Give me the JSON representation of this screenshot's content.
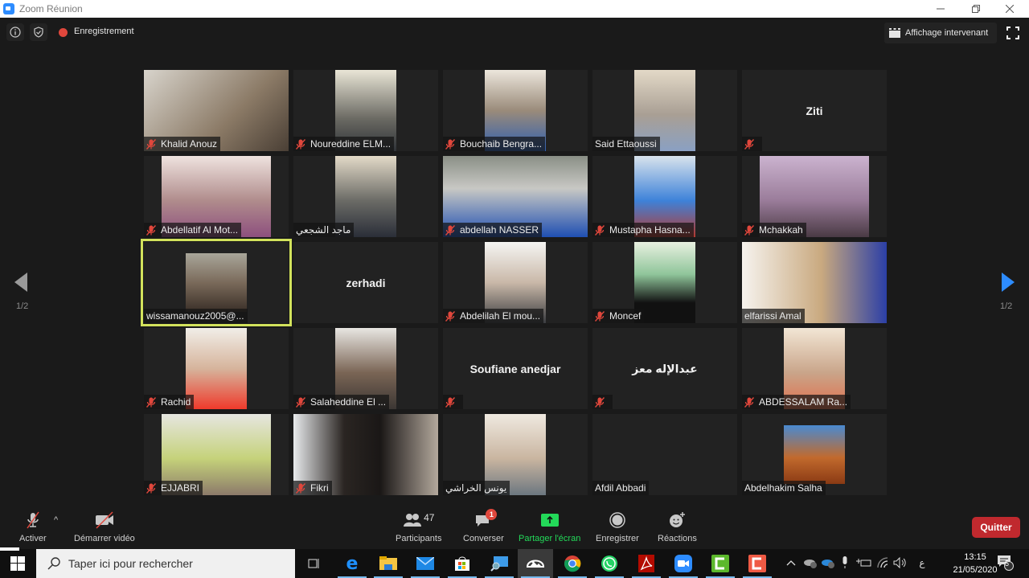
{
  "window": {
    "title": "Zoom Réunion",
    "controls": [
      "minimize",
      "restore",
      "close"
    ]
  },
  "topbar": {
    "recording_label": "Enregistrement",
    "speaker_view_label": "Affichage intervenant"
  },
  "pagination": {
    "left": "1/2",
    "right": "1/2"
  },
  "participants": [
    {
      "name": "Khalid Anouz",
      "muted": true,
      "video": "wide"
    },
    {
      "name": "Noureddine ELM...",
      "muted": true,
      "video": "narrow"
    },
    {
      "name": "Bouchaib Bengra...",
      "muted": true,
      "video": "narrow"
    },
    {
      "name": "Said Ettaoussi",
      "muted": false,
      "video": "narrow"
    },
    {
      "name": "",
      "display_name": "Ziti",
      "muted": true,
      "video": "none"
    },
    {
      "name": "Abdellatif Al Mot...",
      "muted": true,
      "video": "wide-ish"
    },
    {
      "name": "ماجد الشجعي",
      "muted": false,
      "video": "narrow"
    },
    {
      "name": "abdellah NASSER",
      "muted": true,
      "video": "wide"
    },
    {
      "name": "Mustapha Hasna...",
      "muted": true,
      "video": "narrow"
    },
    {
      "name": "Mchakkah",
      "muted": true,
      "video": "wide-ish"
    },
    {
      "name": "wissamanouz2005@...",
      "muted": false,
      "video": "narrow",
      "active_speaker": true
    },
    {
      "name": "",
      "display_name": "zerhadi",
      "muted": false,
      "video": "none"
    },
    {
      "name": "Abdelilah El mou...",
      "muted": true,
      "video": "narrow"
    },
    {
      "name": "Moncef",
      "muted": true,
      "video": "narrow"
    },
    {
      "name": "elfarissi Amal",
      "muted": false,
      "video": "wide"
    },
    {
      "name": "Rachid",
      "muted": true,
      "video": "narrow"
    },
    {
      "name": "Salaheddine El ...",
      "muted": true,
      "video": "narrow"
    },
    {
      "name": "",
      "display_name": "Soufiane anedjar",
      "muted": true,
      "video": "none"
    },
    {
      "name": "",
      "display_name": "عبدالإله معز",
      "muted": true,
      "video": "none"
    },
    {
      "name": "ABDESSALAM Ra...",
      "muted": true,
      "video": "narrow"
    },
    {
      "name": "EJJABRI",
      "muted": true,
      "video": "wide-ish"
    },
    {
      "name": "Fikri",
      "muted": true,
      "video": "wide"
    },
    {
      "name": "يونس الخراشي",
      "muted": false,
      "video": "narrow"
    },
    {
      "name": "Afdil Abbadi",
      "muted": false,
      "video": "none"
    },
    {
      "name": "Abdelhakim Salha",
      "muted": false,
      "video": "photo"
    }
  ],
  "toolbar": {
    "mute_label": "Activer",
    "video_label": "Démarrer vidéo",
    "participants_label": "Participants",
    "participants_count": "47",
    "chat_label": "Converser",
    "chat_badge": "1",
    "share_label": "Partager l'écran",
    "record_label": "Enregistrer",
    "reactions_label": "Réactions",
    "quit_label": "Quitter"
  },
  "colors": {
    "accent_blue": "#2d8cff",
    "share_green": "#23d959",
    "quit_red": "#c0292e",
    "active_speaker_border": "#d2e25c",
    "mute_red": "#e0473c"
  },
  "taskbar": {
    "search_placeholder": "Taper ici pour rechercher",
    "apps": [
      "task-view",
      "edge",
      "file-explorer",
      "mail",
      "store",
      "remote-desktop",
      "photos",
      "chrome",
      "whatsapp",
      "acrobat",
      "zoom",
      "camtasia-green",
      "camtasia-red"
    ],
    "tray": {
      "language": "ع",
      "time": "13:15",
      "date": "21/05/2020",
      "notifications": "5"
    }
  }
}
